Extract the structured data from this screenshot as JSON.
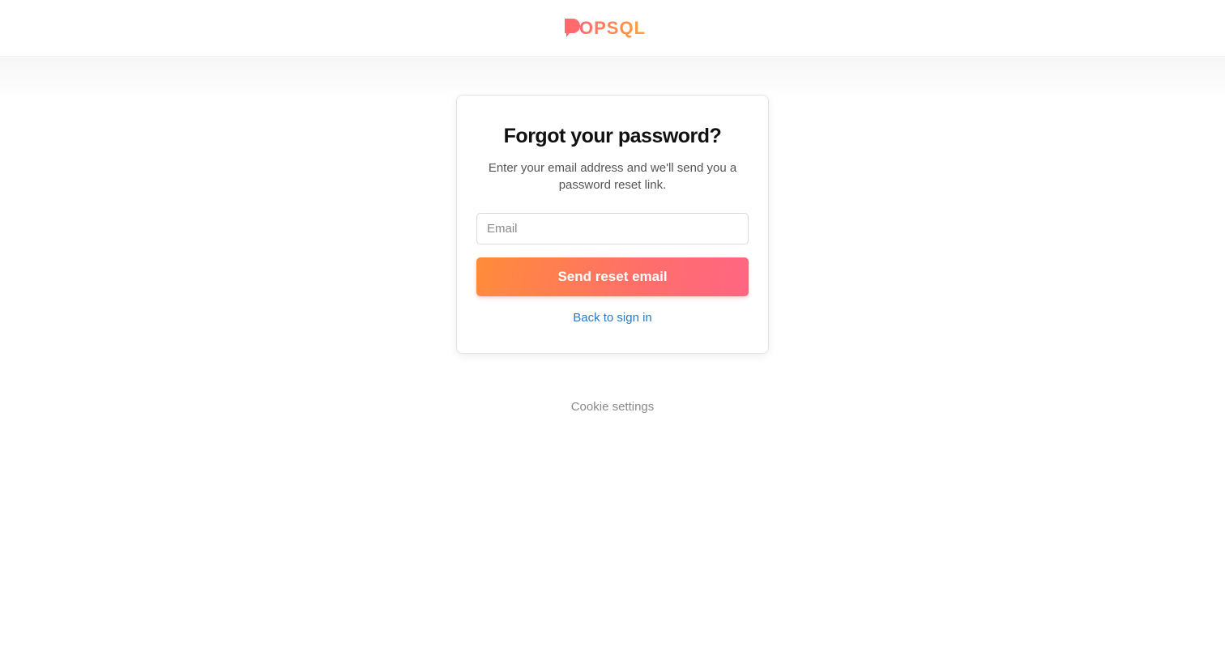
{
  "header": {
    "logo_text": "POPSQL",
    "logo_colors": [
      "#ff6f6a",
      "#ff9a3a"
    ]
  },
  "card": {
    "title": "Forgot your password?",
    "subtitle": "Enter your email address and we'll send you a password reset link.",
    "email": {
      "placeholder": "Email",
      "value": ""
    },
    "send_button_label": "Send reset email",
    "back_link_label": "Back to sign in"
  },
  "footer": {
    "cookie_settings_label": "Cookie settings"
  },
  "colors": {
    "accent_start": "#ff8c3a",
    "accent_end": "#ff6583",
    "link": "#2a7ac4"
  }
}
